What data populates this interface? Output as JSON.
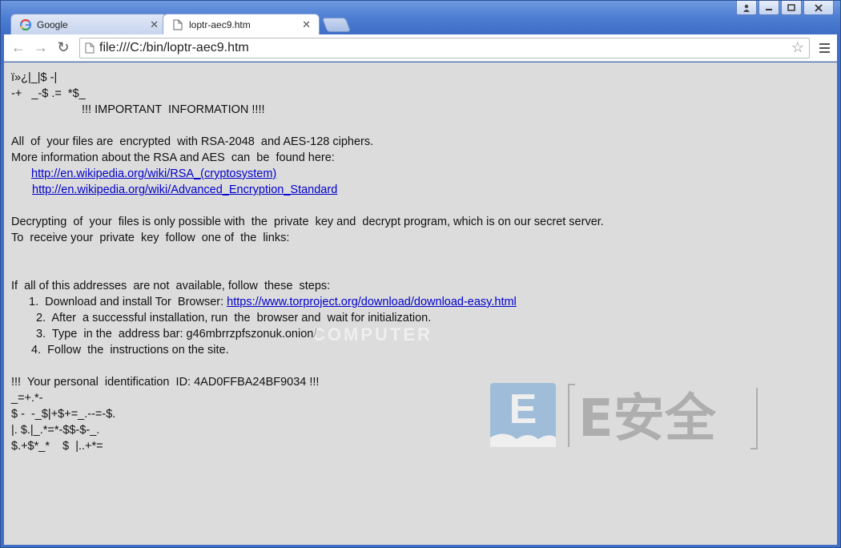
{
  "window": {
    "controls": [
      "user",
      "minimize",
      "maximize",
      "close"
    ]
  },
  "tabs": [
    {
      "title": "Google",
      "active": false,
      "icon": "google-icon"
    },
    {
      "title": "loptr-aec9.htm",
      "active": true,
      "icon": "page-icon"
    }
  ],
  "toolbar": {
    "back_icon": "←",
    "forward_icon": "→",
    "reload_icon": "↻",
    "url": "file:///C:/bin/loptr-aec9.htm",
    "star_icon": "☆"
  },
  "page": {
    "line1": "ï»¿|_|$ -|",
    "line2": "-+   _-$ .=  *$_",
    "heading": "!!! IMPORTANT  INFORMATION !!!!",
    "p1": "All  of  your files are  encrypted  with RSA-2048  and AES-128 ciphers.",
    "p2": "More information about the RSA and AES  can  be  found here:",
    "link1": "http://en.wikipedia.org/wiki/RSA_(cryptosystem)",
    "link2": "http://en.wikipedia.org/wiki/Advanced_Encryption_Standard",
    "p3": "Decrypting  of  your  files is only possible with  the  private  key and  decrypt program, which is on our secret server.",
    "p4": "To  receive your  private  key  follow  one of  the  links:",
    "p5": "If  all of this addresses  are not  available, follow  these  steps:",
    "step1_text": "1.  Download and install Tor  Browser: ",
    "step1_link": "https://www.torproject.org/download/download-easy.html",
    "step2": "2.  After  a successful installation, run  the  browser and  wait for initialization.",
    "step3": "3.  Type  in the  address bar: g46mbrrzpfszonuk.onion/",
    "step4": "4.  Follow  the  instructions on the site.",
    "id_line": "!!!  Your personal  identification  ID: 4AD0FFBA24BF9034 !!!",
    "junk1": "_=+.*-",
    "junk2": "$ -  -_$|+$+=_.--=-$.",
    "junk3": "|. $.|_.*=*-$$-$-_.",
    "junk4": "$.+$*_*    $  |..+*="
  },
  "watermarks": {
    "computer": "COMPUTER",
    "logo_letter": "E",
    "logo_text": "E安全"
  }
}
